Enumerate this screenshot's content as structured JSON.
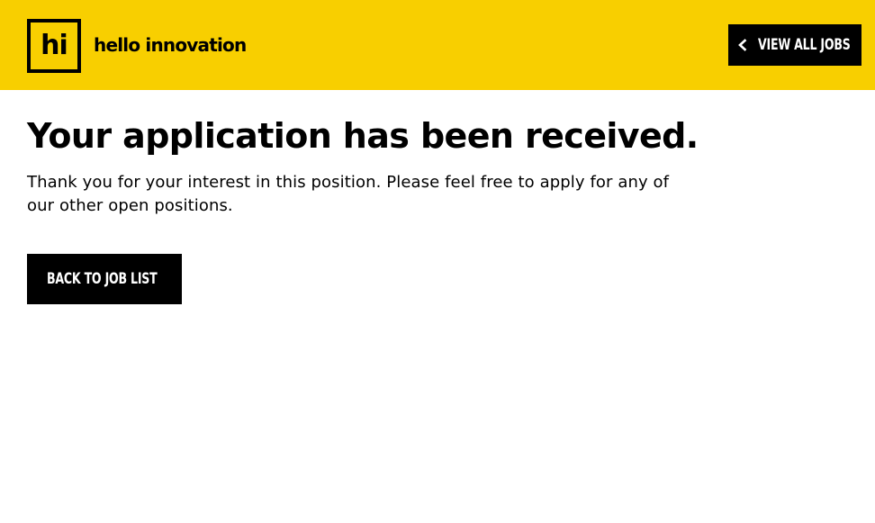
{
  "header": {
    "logo_mark": "hi",
    "logo_text": "hello innovation",
    "view_all_label": "VIEW ALL JOBS",
    "background_color": "#f8cf00"
  },
  "main": {
    "title": "Your application has been received.",
    "message": "Thank you for your interest in this position. Please feel free to apply for any of our other open positions.",
    "back_button_label": "BACK TO JOB LIST"
  },
  "icons": {
    "view_all": "chevron-left-icon"
  }
}
